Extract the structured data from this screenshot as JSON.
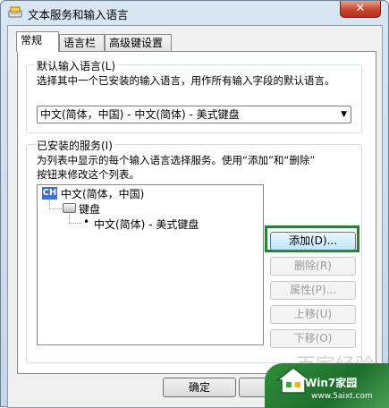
{
  "window": {
    "title": "文本服务和输入语言",
    "close_glyph": "✕"
  },
  "tabs": [
    {
      "label": "常规",
      "active": true
    },
    {
      "label": "语言栏",
      "active": false
    },
    {
      "label": "高级键设置",
      "active": false
    }
  ],
  "default_language": {
    "legend": "默认输入语言(L)",
    "description": "选择其中一个已安装的输入语言，用作所有输入字段的默认语言。",
    "selected": "中文(简体，中国) - 中文(简体) - 美式键盘"
  },
  "installed_services": {
    "legend": "已安装的服务(I)",
    "description_line1": "为列表中显示的每个输入语言选择服务。使用“添加”和“删除”",
    "description_line2": "按钮来修改这个列表。",
    "tree": {
      "language_badge": "CH",
      "language": "中文(简体，中国)",
      "category": "键盘",
      "service_bullet": "•",
      "service": "中文(简体) - 美式键盘"
    }
  },
  "buttons": {
    "add": "添加(D)...",
    "remove": "删除(R)",
    "properties": "属性(P)...",
    "move_up": "上移(U)",
    "move_down": "下移(O)"
  },
  "footer": {
    "ok": "确定"
  },
  "watermark": {
    "faded_text": "百家经验",
    "brand": "Win7家园",
    "url": "www.5aixt.com"
  },
  "colors": {
    "highlight_box": "#2e7d32",
    "language_badge": "#3a74c8"
  }
}
